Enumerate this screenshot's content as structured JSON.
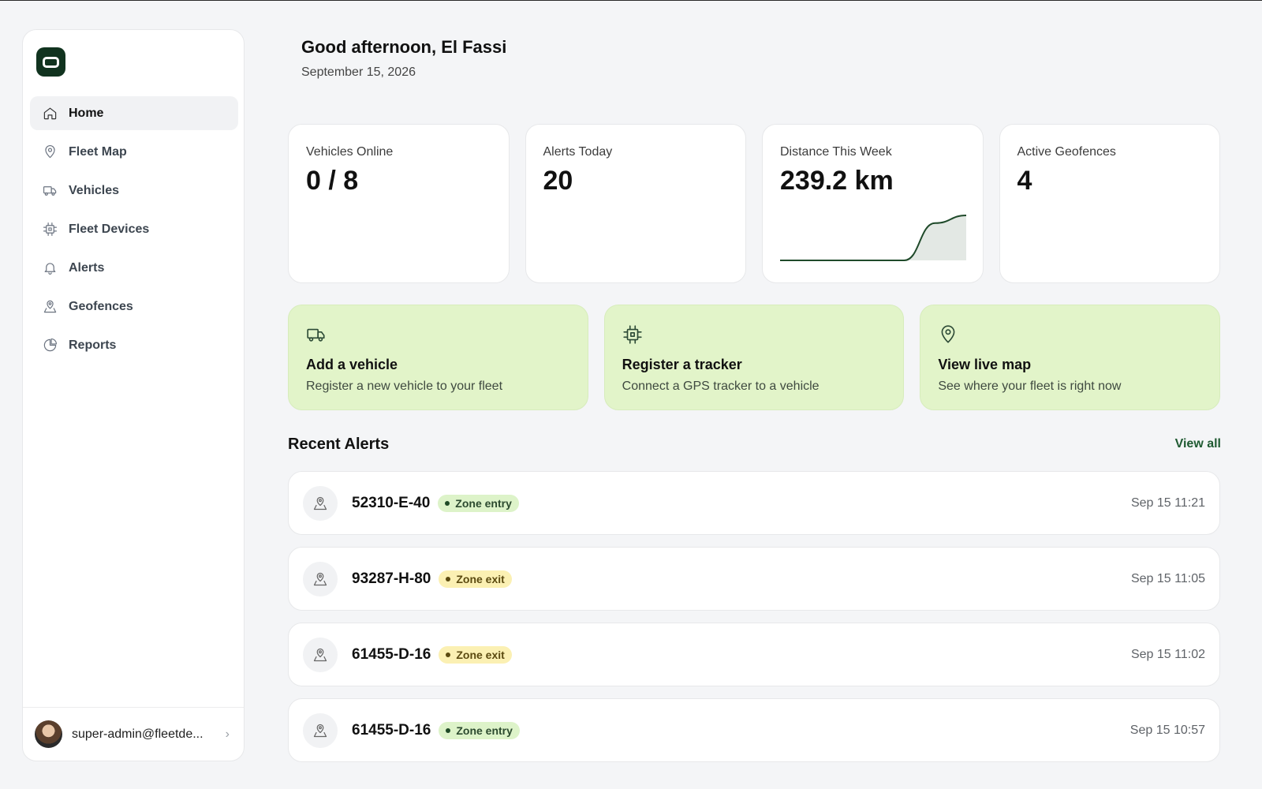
{
  "sidebar": {
    "logo_icon": "app-logo-icon",
    "items": [
      {
        "label": "Home",
        "icon": "home-icon",
        "active": true
      },
      {
        "label": "Fleet Map",
        "icon": "map-pin-icon"
      },
      {
        "label": "Vehicles",
        "icon": "truck-icon"
      },
      {
        "label": "Fleet Devices",
        "icon": "chip-icon"
      },
      {
        "label": "Alerts",
        "icon": "bell-icon"
      },
      {
        "label": "Geofences",
        "icon": "geofence-icon"
      },
      {
        "label": "Reports",
        "icon": "pie-chart-icon"
      }
    ],
    "user": {
      "email": "super-admin@fleetde..."
    }
  },
  "header": {
    "greeting": "Good afternoon, El Fassi",
    "date": "September 15, 2026"
  },
  "stats": [
    {
      "label": "Vehicles Online",
      "value": "0 / 8"
    },
    {
      "label": "Alerts Today",
      "value": "20"
    },
    {
      "label": "Distance This Week",
      "value": "239.2 km"
    },
    {
      "label": "Active Geofences",
      "value": "4"
    }
  ],
  "actions": [
    {
      "title": "Add a vehicle",
      "desc": "Register a new vehicle to your fleet",
      "icon": "truck-icon"
    },
    {
      "title": "Register a tracker",
      "desc": "Connect a GPS tracker to a vehicle",
      "icon": "chip-icon"
    },
    {
      "title": "View live map",
      "desc": "See where your fleet is right now",
      "icon": "map-pin-icon"
    }
  ],
  "recent_alerts": {
    "title": "Recent Alerts",
    "view_all": "View all",
    "items": [
      {
        "plate": "52310-E-40",
        "type": "Zone entry",
        "kind": "entry",
        "time": "Sep 15 11:21"
      },
      {
        "plate": "93287-H-80",
        "type": "Zone exit",
        "kind": "exit",
        "time": "Sep 15 11:05"
      },
      {
        "plate": "61455-D-16",
        "type": "Zone exit",
        "kind": "exit",
        "time": "Sep 15 11:02"
      },
      {
        "plate": "61455-D-16",
        "type": "Zone entry",
        "kind": "entry",
        "time": "Sep 15 10:57"
      }
    ]
  },
  "colors": {
    "accent": "#11331f",
    "action_bg": "#e2f4c9",
    "entry_badge": "#ddf3c9",
    "exit_badge": "#fbf0b3",
    "sparkline": "#1f4a2a"
  },
  "chart_data": {
    "type": "area",
    "title": "",
    "xlabel": "",
    "ylabel": "",
    "x": [
      1,
      2,
      3,
      4,
      5,
      6,
      7
    ],
    "values": [
      0,
      0,
      0,
      0,
      0,
      198,
      239.2
    ],
    "grid": false
  }
}
